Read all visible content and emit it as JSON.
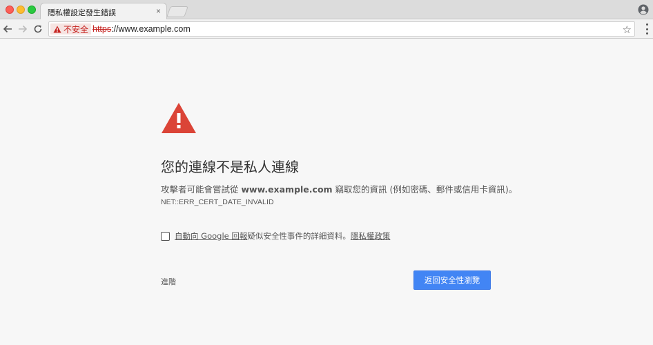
{
  "window": {
    "tab_title": "隱私權設定發生錯誤",
    "tab_close": "×"
  },
  "toolbar": {
    "security_label": "不安全",
    "url_scheme": "https",
    "url_rest": "://www.example.com",
    "star_glyph": "☆"
  },
  "interstitial": {
    "heading": "您的連線不是私人連線",
    "explain_prefix": "攻擊者可能會嘗試從 ",
    "explain_domain": "www.example.com",
    "explain_suffix": " 竊取您的資訊 (例如密碼、郵件或信用卡資訊)。",
    "error_code": "NET::ERR_CERT_DATE_INVALID",
    "checkbox_link": "自動向 Google 回報",
    "checkbox_text": "疑似安全性事件的詳細資料。",
    "privacy_link": "隱私權政策",
    "advanced_label": "進階",
    "back_button": "返回安全性瀏覽"
  },
  "colors": {
    "warning_red": "#db4437",
    "primary_blue": "#4285f4",
    "insecure_red": "#c5221f"
  }
}
